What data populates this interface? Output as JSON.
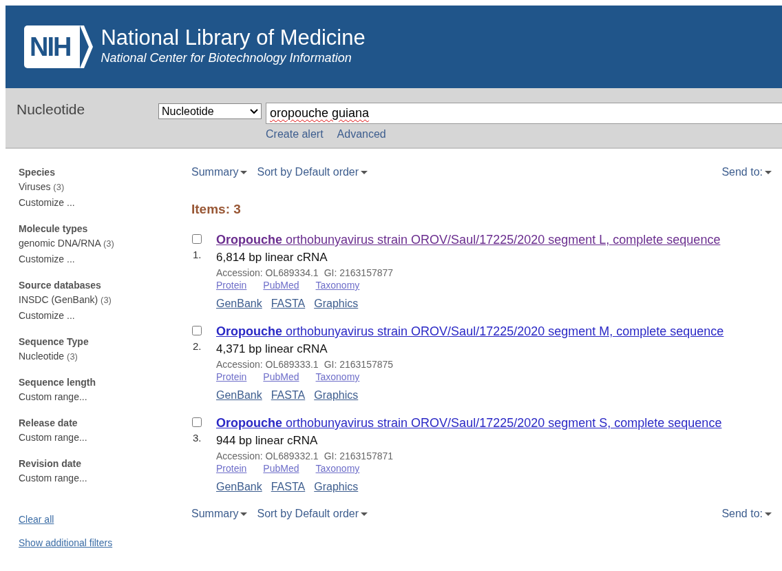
{
  "header": {
    "logo": "NIH",
    "title": "National Library of Medicine",
    "subtitle": "National Center for Biotechnology Information"
  },
  "search": {
    "database_label": "Nucleotide",
    "database_select": "Nucleotide",
    "query": "oropouche guiana",
    "links": [
      "Create alert",
      "Advanced"
    ]
  },
  "sidebar": {
    "groups": [
      {
        "title": "Species",
        "items": [
          {
            "label": "Viruses",
            "count": "(3)"
          },
          {
            "label": "Customize ..."
          }
        ]
      },
      {
        "title": "Molecule types",
        "items": [
          {
            "label": "genomic DNA/RNA",
            "count": "(3)"
          },
          {
            "label": "Customize ..."
          }
        ]
      },
      {
        "title": "Source databases",
        "items": [
          {
            "label": "INSDC (GenBank)",
            "count": "(3)"
          },
          {
            "label": "Customize ..."
          }
        ]
      },
      {
        "title": "Sequence Type",
        "items": [
          {
            "label": "Nucleotide",
            "count": "(3)"
          }
        ]
      },
      {
        "title": "Sequence length",
        "items": [
          {
            "label": "Custom range..."
          }
        ]
      },
      {
        "title": "Release date",
        "items": [
          {
            "label": "Custom range..."
          }
        ]
      },
      {
        "title": "Revision date",
        "items": [
          {
            "label": "Custom range..."
          }
        ]
      }
    ],
    "links": [
      "Clear all",
      "Show additional filters"
    ]
  },
  "top_toolbar": {
    "format": "Summary",
    "sort": "Sort by Default order",
    "send": "Send to:"
  },
  "items_count": "Items: 3",
  "results": [
    {
      "number": "1.",
      "checked": false,
      "visited": true,
      "title": "**Oropouche** orthobunyavirus strain OROV/Saul/17225/2020 segment L, complete sequence",
      "description": "6,814 bp linear cRNA",
      "accession": "Accession: OL689334.1",
      "gi": "GI: 2163157877",
      "related_links": [
        "Protein",
        "PubMed",
        "Taxonomy"
      ],
      "format_links": [
        "GenBank",
        "FASTA",
        "Graphics"
      ]
    },
    {
      "number": "2.",
      "checked": false,
      "visited": false,
      "title": "**Oropouche** orthobunyavirus strain OROV/Saul/17225/2020 segment M, complete sequence",
      "description": "4,371 bp linear cRNA",
      "accession": "Accession: OL689333.1",
      "gi": "GI: 2163157875",
      "related_links": [
        "Protein",
        "PubMed",
        "Taxonomy"
      ],
      "format_links": [
        "GenBank",
        "FASTA",
        "Graphics"
      ]
    },
    {
      "number": "3.",
      "checked": false,
      "visited": false,
      "title": "**Oropouche** orthobunyavirus strain OROV/Saul/17225/2020 segment S, complete sequence",
      "description": "944 bp linear cRNA",
      "accession": "Accession: OL689332.1",
      "gi": "GI: 2163157871",
      "related_links": [
        "Protein",
        "PubMed",
        "Taxonomy"
      ],
      "format_links": [
        "GenBank",
        "FASTA",
        "Graphics"
      ]
    }
  ],
  "bottom_toolbar": {
    "format": "Summary",
    "sort": "Sort by Default order",
    "send": "Send to:"
  }
}
